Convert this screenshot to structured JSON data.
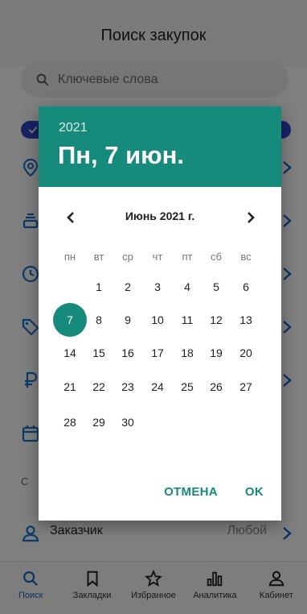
{
  "app": {
    "title": "Поиск закупок",
    "search": {
      "placeholder": "Ключевые слова"
    },
    "chip_left_icon": "checkmark-icon",
    "rows": [
      {
        "icon": "location-pin-icon"
      },
      {
        "icon": "stack-icon"
      },
      {
        "icon": "clock-icon"
      },
      {
        "icon": "tag-icon"
      },
      {
        "icon": "ruble-icon"
      },
      {
        "icon": "calendar-icon"
      },
      {
        "icon": "text-c",
        "label": "С"
      },
      {
        "icon": "customer-icon",
        "label": "Заказчик",
        "value": "Любой"
      }
    ],
    "bottom_nav": [
      {
        "label": "Поиск",
        "icon": "search-icon",
        "active": true
      },
      {
        "label": "Закладки",
        "icon": "bookmark-icon",
        "active": false
      },
      {
        "label": "Избранное",
        "icon": "star-icon",
        "active": false
      },
      {
        "label": "Аналитика",
        "icon": "analytics-icon",
        "active": false
      },
      {
        "label": "Кабинет",
        "icon": "person-icon",
        "active": false
      }
    ]
  },
  "date_picker": {
    "year": "2021",
    "selected_date": "Пн, 7 июн.",
    "month_label": "Июнь 2021 г.",
    "weekdays": [
      "пн",
      "вт",
      "ср",
      "чт",
      "пт",
      "сб",
      "вс"
    ],
    "weeks": [
      [
        "",
        "1",
        "2",
        "3",
        "4",
        "5",
        "6"
      ],
      [
        "7",
        "8",
        "9",
        "10",
        "11",
        "12",
        "13"
      ],
      [
        "14",
        "15",
        "16",
        "17",
        "18",
        "19",
        "20"
      ],
      [
        "21",
        "22",
        "23",
        "24",
        "25",
        "26",
        "27"
      ],
      [
        "28",
        "29",
        "30",
        "",
        "",
        "",
        ""
      ]
    ],
    "selected_day": "7",
    "cancel_label": "ОТМЕНА",
    "ok_label": "OK",
    "accent_color": "#168b7b"
  }
}
